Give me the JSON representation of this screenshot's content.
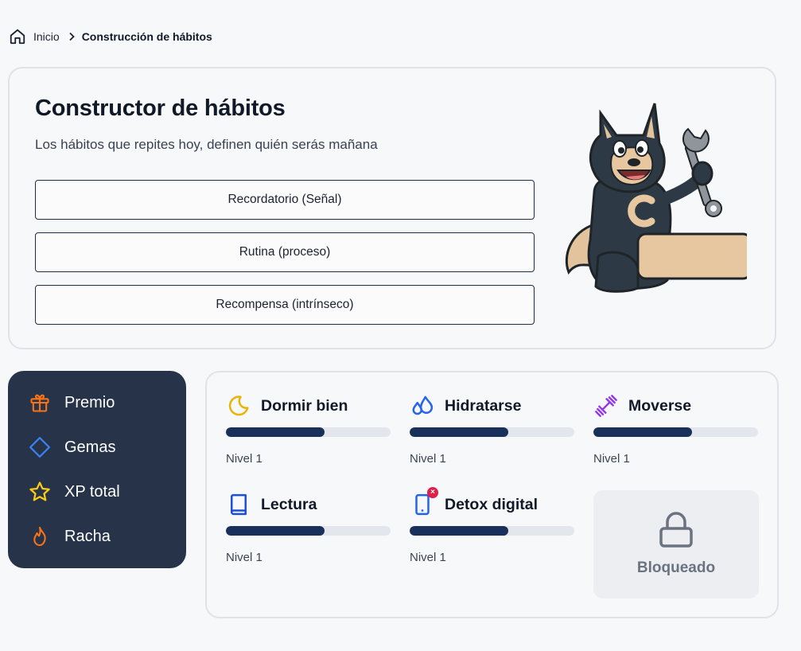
{
  "breadcrumb": {
    "home_label": "Inicio",
    "current_label": "Construcción de hábitos"
  },
  "hero": {
    "title": "Constructor de hábitos",
    "subtitle": "Los hábitos que repites hoy, definen quién serás mañana",
    "buttons": [
      {
        "label": "Recordatorio (Señal)"
      },
      {
        "label": "Rutina (proceso)"
      },
      {
        "label": "Recompensa (intrínseco)"
      }
    ],
    "mascot": {
      "icon": "wolf-mascot-with-wrench",
      "badge_letter": "C"
    }
  },
  "stats": {
    "items": [
      {
        "label": "Premio",
        "icon": "gift-icon",
        "color": "#f97316"
      },
      {
        "label": "Gemas",
        "icon": "gem-icon",
        "color": "#3b82f6"
      },
      {
        "label": "XP total",
        "icon": "star-icon",
        "color": "#facc15"
      },
      {
        "label": "Racha",
        "icon": "flame-icon",
        "color": "#f97316"
      }
    ]
  },
  "habits": {
    "items": [
      {
        "name": "Dormir bien",
        "level": "Nivel 1",
        "progress": 0.6,
        "icon": "moon-icon",
        "color": "#eab308"
      },
      {
        "name": "Hidratarse",
        "level": "Nivel 1",
        "progress": 0.6,
        "icon": "water-drops-icon",
        "color": "#2563eb"
      },
      {
        "name": "Moverse",
        "level": "Nivel 1",
        "progress": 0.6,
        "icon": "dumbbell-icon",
        "color": "#9333ea"
      },
      {
        "name": "Lectura",
        "level": "Nivel 1",
        "progress": 0.6,
        "icon": "book-icon",
        "color": "#1d4ed8"
      },
      {
        "name": "Detox digital",
        "level": "Nivel 1",
        "progress": 0.6,
        "icon": "phone-off-icon",
        "color": "#2563eb"
      }
    ],
    "locked": {
      "label": "Bloqueado",
      "icon": "lock-icon"
    }
  },
  "colors": {
    "accent_dark": "#263348",
    "progress_fill": "#18305a",
    "progress_track": "#e3e6ec"
  }
}
